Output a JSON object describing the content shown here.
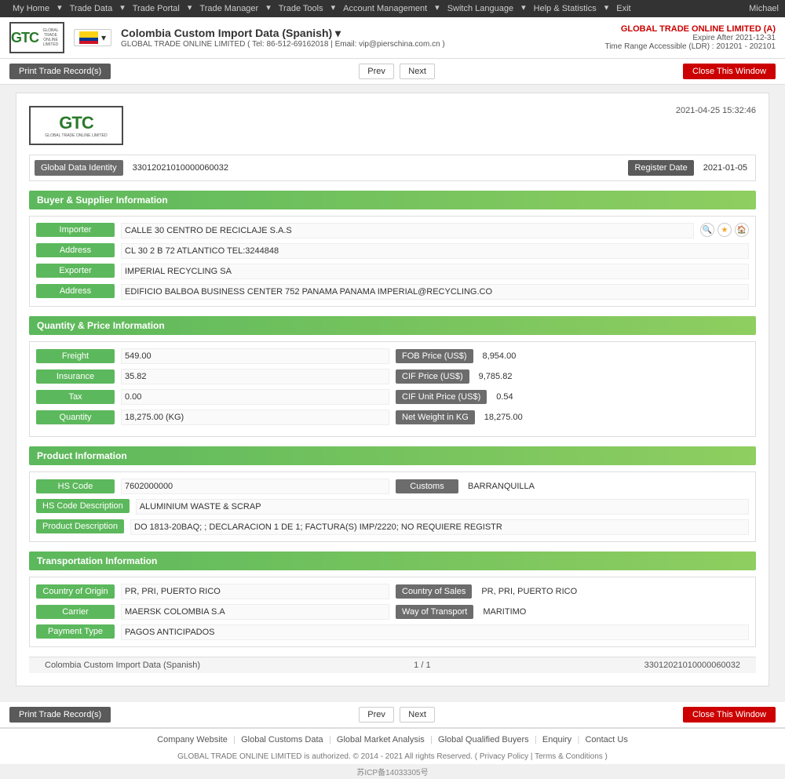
{
  "topnav": {
    "items": [
      "My Home",
      "Trade Data",
      "Trade Portal",
      "Trade Manager",
      "Trade Tools",
      "Account Management",
      "Switch Language",
      "Help & Statistics",
      "Exit"
    ],
    "user": "Michael"
  },
  "header": {
    "logo_top": "GTC",
    "logo_sub": "GLOBAL TRADE ONLINE LIMITED",
    "flag_alt": "Colombia",
    "title": "Colombia Custom Import Data (Spanish)",
    "subtitle": "GLOBAL TRADE ONLINE LIMITED ( Tel: 86-512-69162018 | Email: vip@pierschina.com.cn )",
    "company_name": "GLOBAL TRADE ONLINE LIMITED (A)",
    "expire": "Expire After 2021-12-31",
    "time_range": "Time Range Accessible (LDR) : 201201 - 202101"
  },
  "toolbar": {
    "print_label": "Print Trade Record(s)",
    "prev_label": "Prev",
    "next_label": "Next",
    "close_label": "Close This Window"
  },
  "record": {
    "timestamp": "2021-04-25 15:32:46",
    "global_data_identity_label": "Global Data Identity",
    "global_data_identity_value": "33012021010000060032",
    "register_date_label": "Register Date",
    "register_date_value": "2021-01-05"
  },
  "buyer_supplier": {
    "section_title": "Buyer & Supplier Information",
    "importer_label": "Importer",
    "importer_value": "CALLE 30 CENTRO DE RECICLAJE S.A.S",
    "address1_label": "Address",
    "address1_value": "CL 30 2 B 72 ATLANTICO TEL:3244848",
    "exporter_label": "Exporter",
    "exporter_value": "IMPERIAL RECYCLING SA",
    "address2_label": "Address",
    "address2_value": "EDIFICIO BALBOA BUSINESS CENTER 752 PANAMA PANAMA IMPERIAL@RECYCLING.CO"
  },
  "quantity_price": {
    "section_title": "Quantity & Price Information",
    "freight_label": "Freight",
    "freight_value": "549.00",
    "fob_label": "FOB Price (US$)",
    "fob_value": "8,954.00",
    "insurance_label": "Insurance",
    "insurance_value": "35.82",
    "cif_label": "CIF Price (US$)",
    "cif_value": "9,785.82",
    "tax_label": "Tax",
    "tax_value": "0.00",
    "cif_unit_label": "CIF Unit Price (US$)",
    "cif_unit_value": "0.54",
    "quantity_label": "Quantity",
    "quantity_value": "18,275.00 (KG)",
    "net_weight_label": "Net Weight in KG",
    "net_weight_value": "18,275.00"
  },
  "product_info": {
    "section_title": "Product Information",
    "hs_code_label": "HS Code",
    "hs_code_value": "7602000000",
    "customs_label": "Customs",
    "customs_value": "BARRANQUILLA",
    "hs_desc_label": "HS Code Description",
    "hs_desc_value": "ALUMINIUM WASTE & SCRAP",
    "product_desc_label": "Product Description",
    "product_desc_value": "DO 1813-20BAQ; ; DECLARACION 1 DE 1; FACTURA(S) IMP/2220; NO REQUIERE REGISTR"
  },
  "transportation": {
    "section_title": "Transportation Information",
    "country_origin_label": "Country of Origin",
    "country_origin_value": "PR, PRI, PUERTO RICO",
    "country_sales_label": "Country of Sales",
    "country_sales_value": "PR, PRI, PUERTO RICO",
    "carrier_label": "Carrier",
    "carrier_value": "MAERSK COLOMBIA S.A",
    "way_transport_label": "Way of Transport",
    "way_transport_value": "MARITIMO",
    "payment_label": "Payment Type",
    "payment_value": "PAGOS ANTICIPADOS"
  },
  "footer": {
    "left": "Colombia Custom Import Data (Spanish)",
    "center": "1 / 1",
    "right": "33012021010000060032"
  },
  "bottom_toolbar": {
    "print_label": "Print Trade Record(s)",
    "prev_label": "Prev",
    "next_label": "Next",
    "close_label": "Close This Window"
  },
  "bottom_links": {
    "company_website": "Company Website",
    "global_customs": "Global Customs Data",
    "global_market": "Global Market Analysis",
    "global_buyers": "Global Qualified Buyers",
    "enquiry": "Enquiry",
    "contact": "Contact Us"
  },
  "bottom_footer": {
    "copyright": "GLOBAL TRADE ONLINE LIMITED is authorized. © 2014 - 2021 All rights Reserved.  ( Privacy Policy | Terms & Conditions )",
    "icp": "苏ICP备14033305号"
  }
}
